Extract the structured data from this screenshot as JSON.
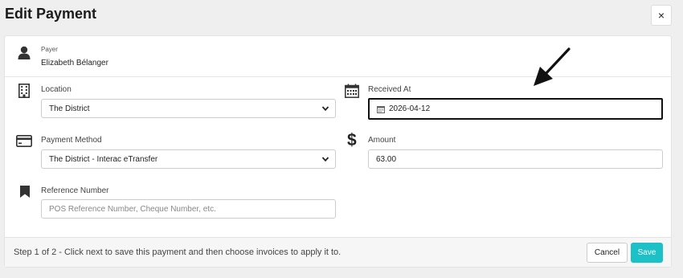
{
  "dialog": {
    "title": "Edit Payment",
    "close_label": "×"
  },
  "payer": {
    "label": "Payer",
    "name": "Elizabeth Bélanger"
  },
  "location": {
    "label": "Location",
    "value": "The District"
  },
  "received_at": {
    "label": "Received At",
    "value": "2026-04-12"
  },
  "payment_method": {
    "label": "Payment Method",
    "value": "The District - Interac eTransfer"
  },
  "amount": {
    "label": "Amount",
    "value": "63.00"
  },
  "reference": {
    "label": "Reference Number",
    "placeholder": "POS Reference Number, Cheque Number, etc."
  },
  "footer": {
    "step_text": "Step 1 of 2 - Click next to save this payment and then choose invoices to apply it to.",
    "cancel_label": "Cancel",
    "save_label": "Save"
  },
  "colors": {
    "accent": "#1cc0c7",
    "focus_border": "#111111"
  }
}
